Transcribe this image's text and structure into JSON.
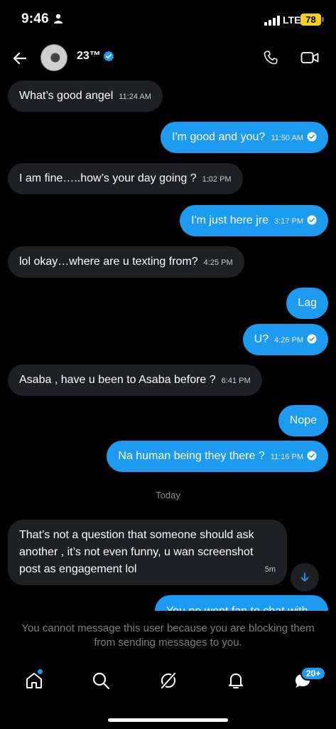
{
  "status_bar": {
    "time": "9:46",
    "network": "LTE",
    "battery": "78"
  },
  "header": {
    "contact_name": "23™"
  },
  "messages": [
    {
      "text": "What’s good angel",
      "time": "11:24 AM"
    },
    {
      "text": "I'm good and you?",
      "time": "11:50 AM"
    },
    {
      "text": "I am fine…..how’s your day going ?",
      "time": "1:02 PM"
    },
    {
      "text": "I'm just here jre",
      "time": "3:17 PM"
    },
    {
      "text": "lol okay…where are u texting from?",
      "time": "4:25 PM"
    },
    {
      "text": "Lag"
    },
    {
      "text": "U?",
      "time": "4:26 PM"
    },
    {
      "text": "Asaba , have u been to Asaba before ?",
      "time": "6:41 PM"
    },
    {
      "text": "Nope"
    },
    {
      "text": "Na human being they there ?",
      "time": "11:16 PM"
    }
  ],
  "date_separator": "Today",
  "latest_message": {
    "text": "That’s not a question that someone should ask another , it’s not even funny, u wan screenshot post as engagement lol",
    "time": "5m"
  },
  "partial_message": {
    "text": "You no wont fan to chat with"
  },
  "blocked_notice": "You cannot message this user because you are blocking them from sending messages to you.",
  "nav": {
    "messages_badge": "20+"
  },
  "colors": {
    "accent": "#1d9bf0",
    "incoming_bubble": "#1f2023",
    "background": "#000000"
  }
}
